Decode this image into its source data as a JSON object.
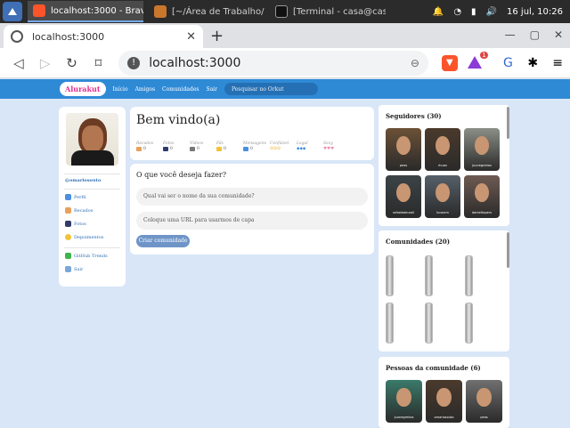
{
  "taskbar": {
    "tasks": [
      "localhost:3000 - Brave",
      "[~/Área de Trabalho/F...",
      "[Terminal - casa@cas..."
    ],
    "clock": "16 jul, 10:26"
  },
  "browser": {
    "tab_title": "localhost:3000",
    "url": "localhost:3000",
    "badge_count": "1"
  },
  "site": {
    "logo": "Alurakut",
    "nav": [
      "Início",
      "Amigos",
      "Comunidades"
    ],
    "logout": "Sair",
    "search_placeholder": "Pesquisar no Orkut"
  },
  "profile": {
    "username": "@omariosouto",
    "menu": [
      "Perfil",
      "Recados",
      "Fotos",
      "Depoimentos"
    ],
    "menu2": [
      "GitHub Trends",
      "Sair"
    ]
  },
  "welcome": {
    "title": "Bem vindo(a)",
    "stats": [
      {
        "label": "Recados",
        "value": "0"
      },
      {
        "label": "Fotos",
        "value": "0"
      },
      {
        "label": "Vídeos",
        "value": "0"
      },
      {
        "label": "Fãs",
        "value": "0"
      },
      {
        "label": "Mensagens",
        "value": "0"
      },
      {
        "label": "Confiável",
        "value": ""
      },
      {
        "label": "Legal",
        "value": ""
      },
      {
        "label": "Sexy",
        "value": ""
      }
    ]
  },
  "form": {
    "question": "O que você deseja fazer?",
    "name_placeholder": "Qual vai ser o nome da sua comunidade?",
    "url_placeholder": "Coloque uma URL para usarmos de capa",
    "submit": "Criar comunidade"
  },
  "followers": {
    "title": "Seguidores (30)",
    "people": [
      {
        "name": "peas",
        "color": "#6b5137"
      },
      {
        "name": "rhuan",
        "color": "#4a3a2c"
      },
      {
        "name": "juunegreiros",
        "color": "#8a8f86"
      },
      {
        "name": "rafaeladeuroli",
        "color": "#3c4447"
      },
      {
        "name": "lucasrm",
        "color": "#56606a"
      },
      {
        "name": "danielkspers",
        "color": "#6e5b52"
      }
    ]
  },
  "communities": {
    "title": "Comunidades (20)"
  },
  "members": {
    "title": "Pessoas da comunidade (6)",
    "people": [
      {
        "name": "juunegreiros",
        "color": "#3a7a6a"
      },
      {
        "name": "omariosouto",
        "color": "#4a3a2c"
      },
      {
        "name": "peas",
        "color": "#707070"
      }
    ]
  },
  "colors": {
    "accent": "#2f8ad6",
    "brand": "#e12e8e",
    "button": "#6f95c8"
  }
}
